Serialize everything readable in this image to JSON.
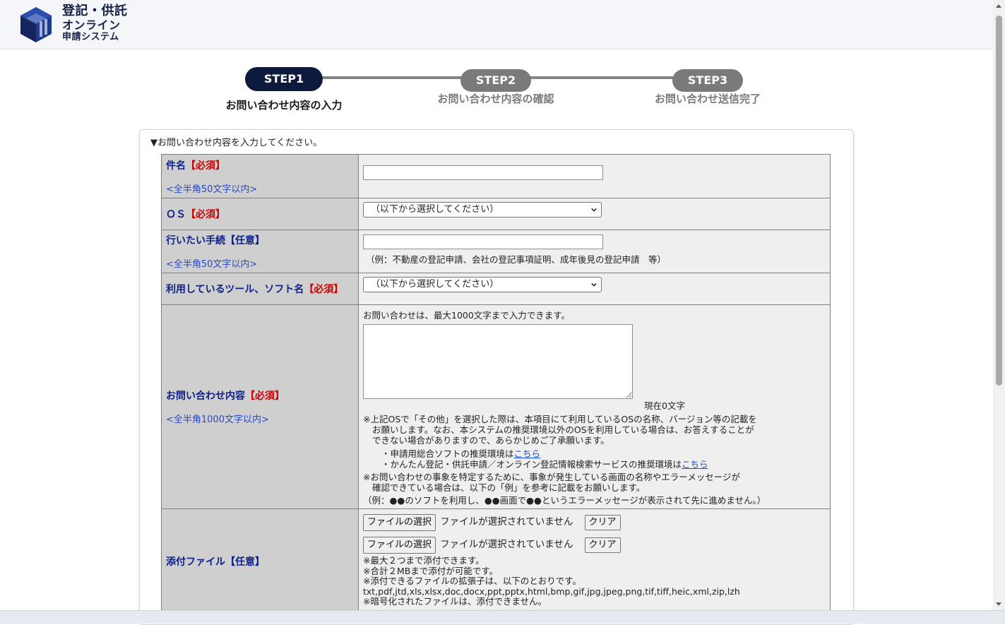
{
  "header": {
    "logo_line1": "登記・供託",
    "logo_line2": "オンライン",
    "logo_line3": "申請システム"
  },
  "steps": [
    {
      "pill": "STEP1",
      "label": "お問い合わせ内容の入力",
      "active": true
    },
    {
      "pill": "STEP2",
      "label": "お問い合わせ内容の確認",
      "active": false
    },
    {
      "pill": "STEP3",
      "label": "お問い合わせ送信完了",
      "active": false
    }
  ],
  "form": {
    "instruction": "▼お問い合わせ内容を入力してください。",
    "subject": {
      "label": "件名",
      "badge": "【必須】",
      "limit": "<全半角50文字以内>",
      "value": ""
    },
    "os": {
      "label": "ＯＳ",
      "badge": "【必須】",
      "selected": "（以下から選択してください）"
    },
    "procedure": {
      "label": "行いたい手続",
      "badge": "【任意】",
      "limit": "<全半角50文字以内>",
      "value": "",
      "example": "（例：不動産の登記申請、会社の登記事項証明、成年後見の登記申請　等）"
    },
    "tool": {
      "label": "利用しているツール、ソフト名",
      "badge": "【必須】",
      "selected": "（以下から選択してください）"
    },
    "inquiry": {
      "label": "お問い合わせ内容",
      "badge": "【必須】",
      "limit": "<全半角1000文字以内>",
      "max_note": "お問い合わせは、最大1000文字まで入力できます。",
      "counter": "現在0文字",
      "note1_l1": "※上記OSで「その他」を選択した際は、本項目にて利用しているOSの名称、バージョン等の記載を",
      "note1_l2": "お願いします。なお、本システムの推奨環境以外のOSを利用している場合は、お答えすることが",
      "note1_l3": "できない場合がありますので、あらかじめご了承願います。",
      "link1_prefix": "・申請用総合ソフトの推奨環境は",
      "link1_text": "こちら",
      "link2_prefix": "・かんたん登記・供託申請／オンライン登記情報検索サービスの推奨環境は",
      "link2_text": "こちら",
      "note2_l1": "※お問い合わせの事象を特定するために、事象が発生している画面の名称やエラーメッセージが",
      "note2_l2": "確認できている場合は、以下の「例」を参考に記載をお願いします。",
      "note2_example": "（例：●●のソフトを利用し、●●画面で●●というエラーメッセージが表示されて先に進めません。）"
    },
    "attachment": {
      "label": "添付ファイル",
      "badge": "【任意】",
      "choose_label": "ファイルの選択",
      "no_file": "ファイルが選択されていません",
      "clear_label": "クリア",
      "note1": "※最大２つまで添付できます。",
      "note2": "※合計２MBまで添付が可能です。",
      "note3": "※添付できるファイルの拡張子は、以下のとおりです。",
      "extensions": "txt,pdf,jtd,xls,xlsx,doc,docx,ppt,pptx,html,bmp,gif,jpg,jpeg,png,tif,tiff,heic,xml,zip,lzh",
      "note4": "※暗号化されたファイルは、添付できません。"
    }
  },
  "colors": {
    "active_step": "#0e1a3d",
    "inactive_step": "#7a7a7a",
    "label_blue": "#0b1f8a",
    "required_red": "#d40000",
    "link_blue": "#1a4ed8"
  }
}
